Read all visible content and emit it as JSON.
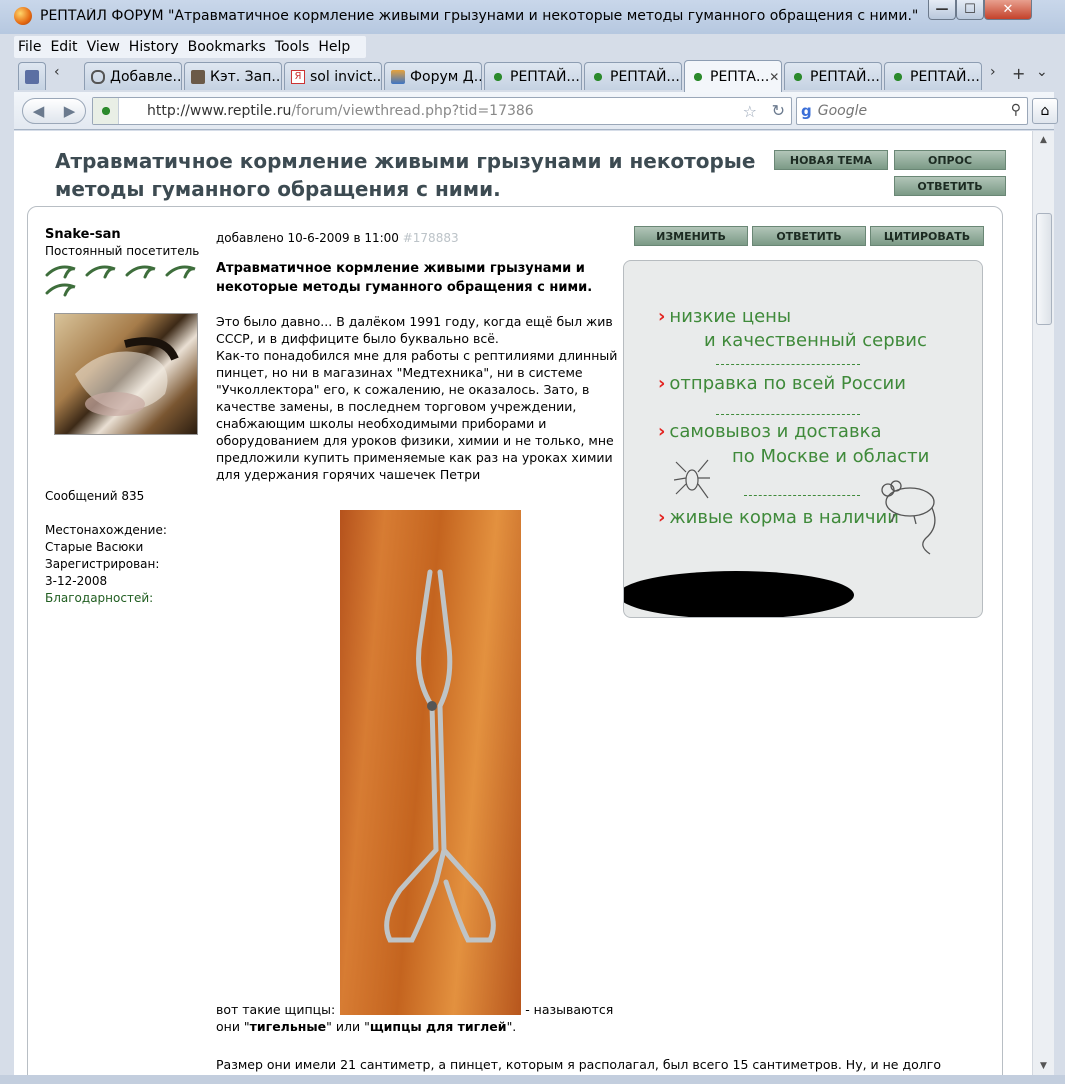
{
  "window": {
    "title": "РЕПТАЙЛ ФОРУМ \"Атравматичное кормление живыми грызунами и некоторые методы гуманного обращения с ними.\" (Статьи)",
    "min_glyph": "—",
    "max_glyph": "☐",
    "close_glyph": "✕"
  },
  "menu": [
    "File",
    "Edit",
    "View",
    "History",
    "Bookmarks",
    "Tools",
    "Help"
  ],
  "tabs": [
    {
      "label": "",
      "icon": "user-icon"
    },
    {
      "label": "Добавле...",
      "icon": "paperclip-icon"
    },
    {
      "label": "Кэт. Зап...",
      "icon": "user-icon"
    },
    {
      "label": "sol invict...",
      "icon": "yandex-icon"
    },
    {
      "label": "Форум Д...",
      "icon": "house-icon"
    },
    {
      "label": "РЕПТАЙ...",
      "icon": "leaf-icon"
    },
    {
      "label": "РЕПТАЙ...",
      "icon": "leaf-icon"
    },
    {
      "label": "РЕПТА...",
      "icon": "leaf-icon",
      "active": true
    },
    {
      "label": "РЕПТАЙ...",
      "icon": "leaf-icon"
    },
    {
      "label": "РЕПТАЙ...",
      "icon": "leaf-icon"
    }
  ],
  "nav": {
    "url_host": "http://www.reptile.ru",
    "url_path": "/forum/viewthread.php?tid=17386",
    "search_placeholder": "Google"
  },
  "thread": {
    "title": "Атравматичное кормление живыми грызунами и некоторые методы гуманного обращения с ними.",
    "new_topic": "НОВАЯ ТЕМА",
    "poll": "ОПРОС",
    "reply": "ОТВЕТИТЬ"
  },
  "author": {
    "name": "Snake-san",
    "rank": "Постоянный посетитель",
    "posts": "Сообщений 835",
    "location_label": "Местонахождение:",
    "location": "Старые Васюки",
    "registered_label": "Зарегистрирован:",
    "registered": "3-12-2008",
    "thanks": "Благодарностей:"
  },
  "post": {
    "date": "добавлено 10-6-2009 в 11:00",
    "id": "#178883",
    "edit": "ИЗМЕНИТЬ",
    "reply": "ОТВЕТИТЬ",
    "quote": "ЦИТИРОВАТЬ",
    "title": "Атравматичное кормление живыми грызунами и некоторые методы гуманного обращения с ними.",
    "p1": "Это было давно... В далёком 1991 году, когда ещё был жив СССР, и в диффиците было буквально всё.",
    "p2": "Как-то понадобился мне для работы с рептилиями длинный пинцет, но ни в магазинах \"Медтехника\", ни в системе \"Учколлектора\" его, к сожалению, не оказалось. Зато, в качестве замены, в последнем торговом учреждении, снабжающим школы необходимыми приборами и оборудованием для уроков физики, химии и не только, мне предложили купить применяемые как раз на уроках химии для удержания горячих чашечек Петри",
    "caption_a": "вот такие щипцы:",
    "caption_b": "- называются",
    "caption_c": "они \"",
    "caption_d": "тигельные",
    "caption_e": "\" или \"",
    "caption_f": "щипцы для тиглей",
    "caption_g": "\".",
    "p3": "Размер они имели 21 сантиметр, а пинцет, которым я располагал, был всего 15 сантиметров. Ну, и не долго"
  },
  "ad": {
    "line1": "низкие цены",
    "line2": "и качественный сервис",
    "line3": "отправка по всей России",
    "line4": "самовывоз и доставка",
    "line5": "по Москве и области",
    "line6": "живые корма в наличии",
    "accent": "#3f8a3a",
    "arrow_color": "#e32421"
  }
}
